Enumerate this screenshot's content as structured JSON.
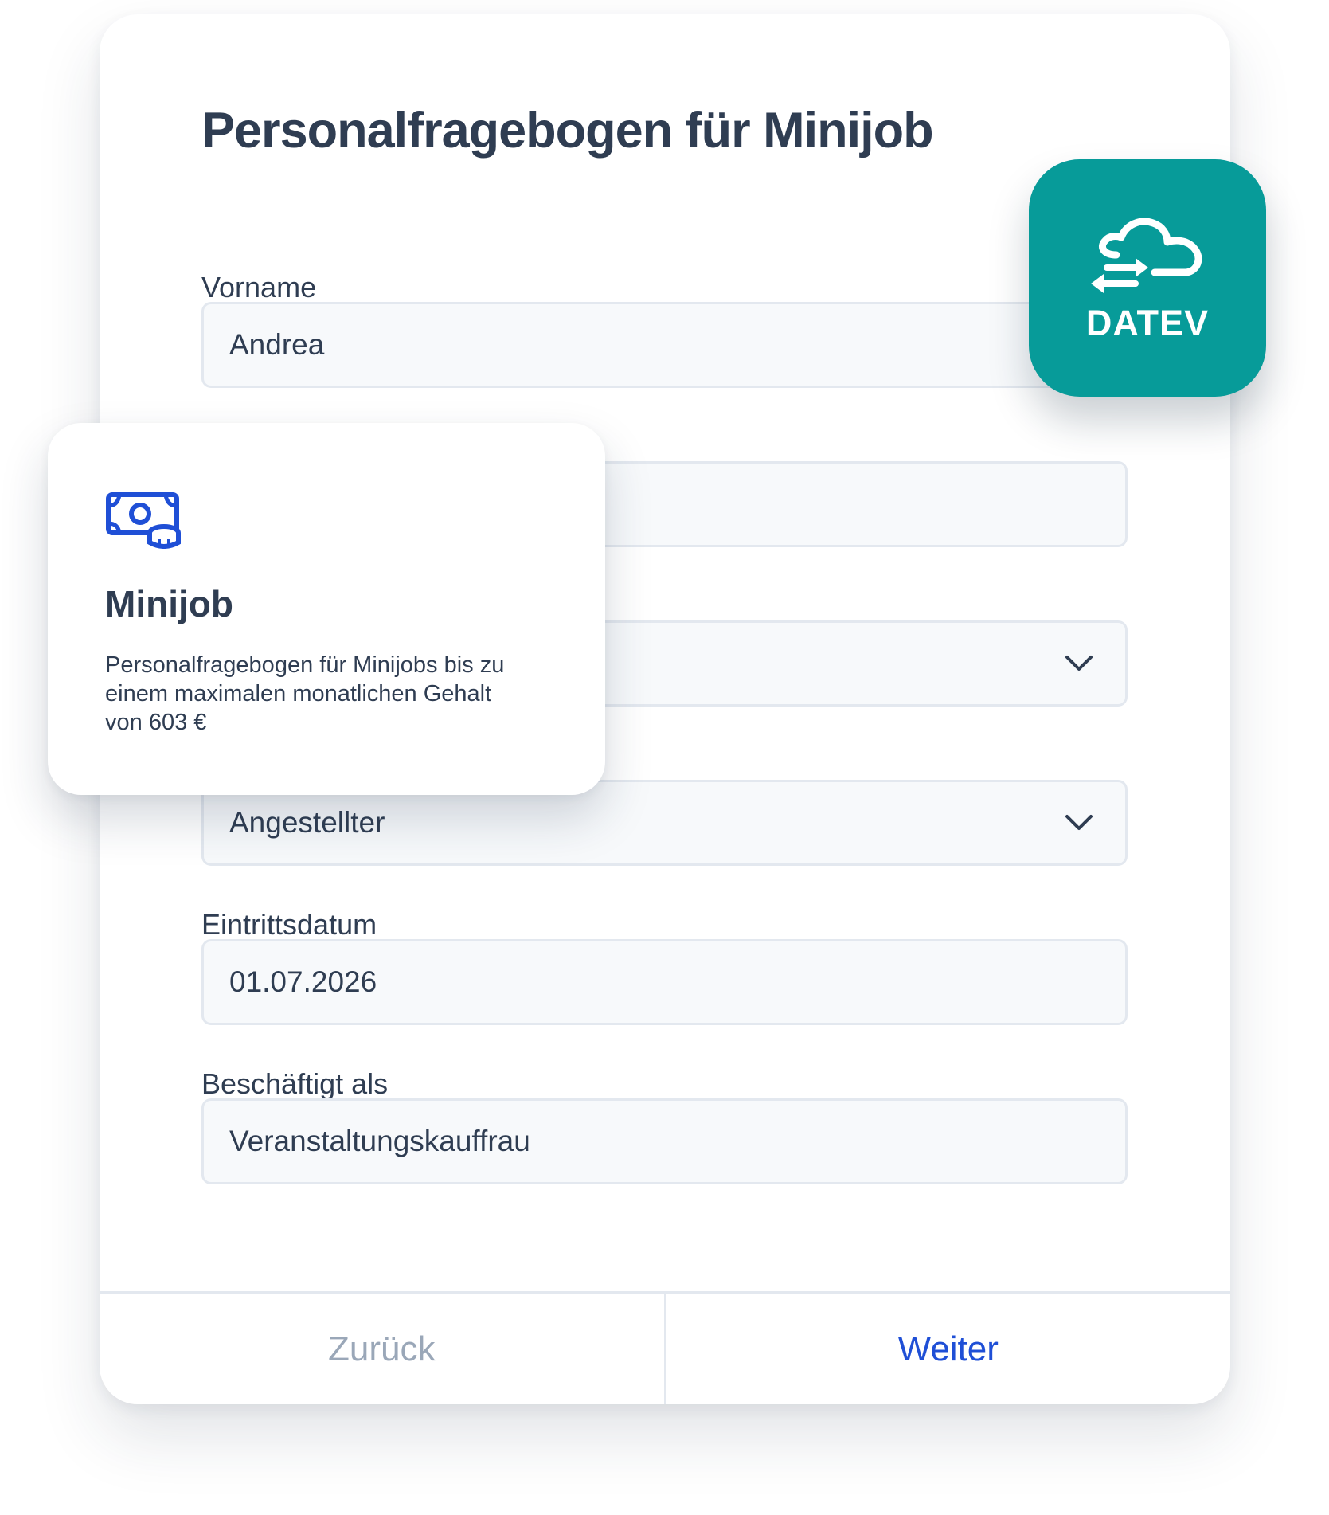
{
  "form": {
    "title": "Personalfragebogen für Minijob",
    "fields": [
      {
        "label": "Vorname",
        "value": "Andrea"
      },
      {
        "label": "",
        "value": ""
      },
      {
        "label": "",
        "value": ""
      },
      {
        "label": "",
        "value": "Angestellter"
      },
      {
        "label": "Eintrittsdatum",
        "value": "01.07.2026"
      },
      {
        "label": "Beschäftigt als",
        "value": "Veranstaltungskauffrau"
      }
    ],
    "back_label": "Zurück",
    "next_label": "Weiter"
  },
  "badge": {
    "brand": "DATEV",
    "icon": "cloud-sync-icon",
    "color": "#079b99"
  },
  "info_card": {
    "icon": "money-coin-icon",
    "title": "Minijob",
    "description": "Personalfragebogen für Minijobs bis zu einem maximalen monatlichen Gehalt von 603 €"
  },
  "colors": {
    "accent": "#1f4fd6",
    "text": "#2f3d52",
    "muted": "#9aa7b8",
    "field_bg": "#f7f9fb",
    "field_border": "#e3e8ef"
  }
}
